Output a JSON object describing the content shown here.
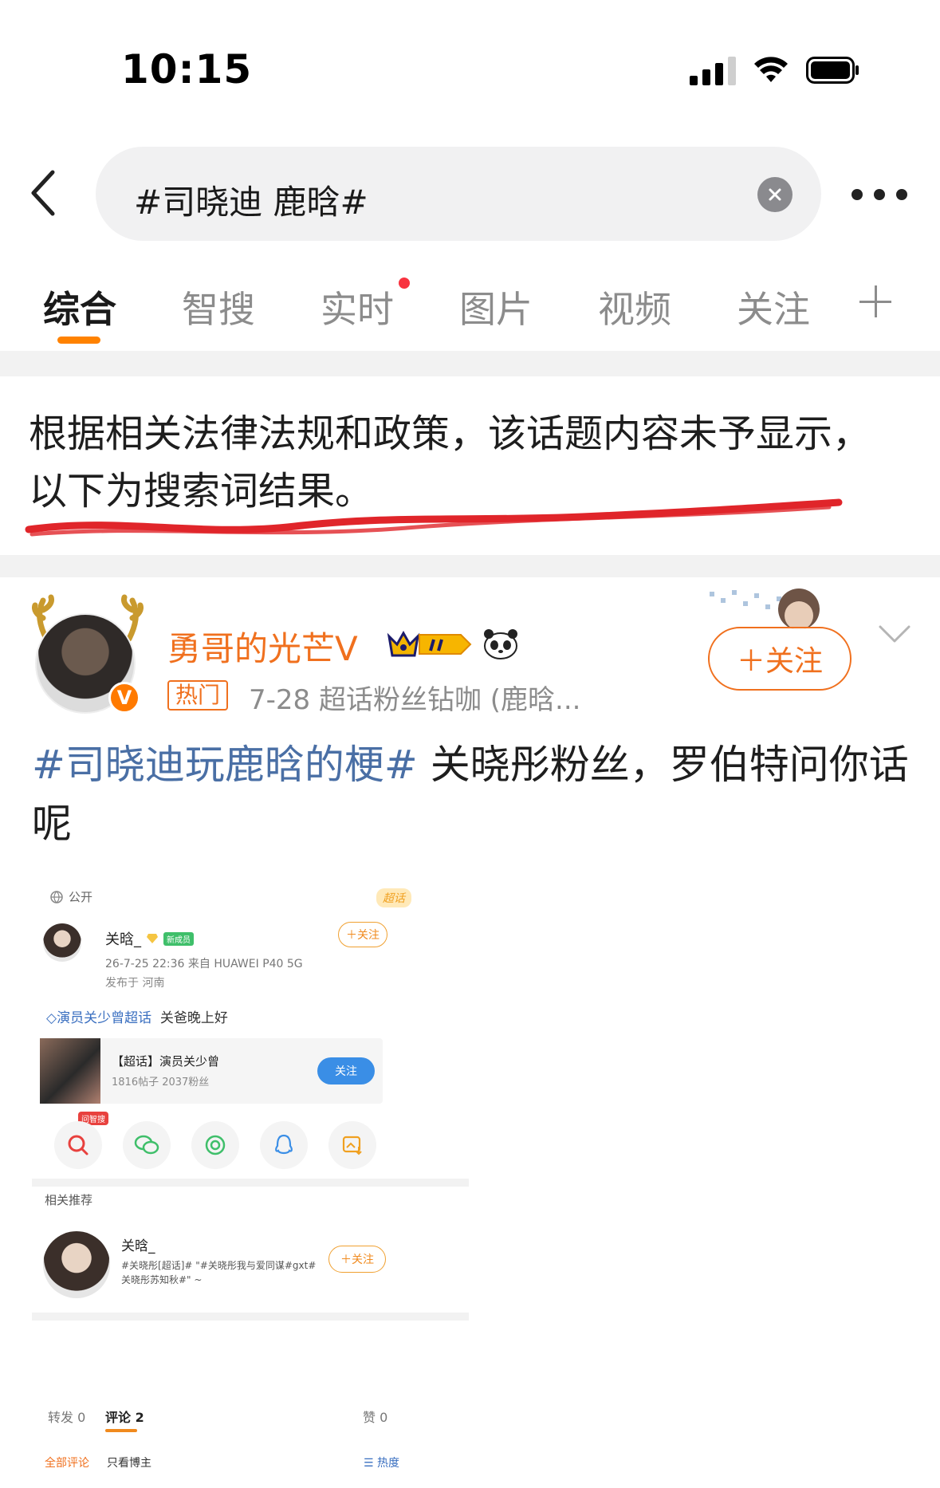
{
  "status_bar": {
    "time": "10:15"
  },
  "search": {
    "query": "#司晓迪 鹿晗#"
  },
  "tabs": [
    {
      "label": "综合"
    },
    {
      "label": "智搜"
    },
    {
      "label": "实时"
    },
    {
      "label": "图片"
    },
    {
      "label": "视频"
    },
    {
      "label": "关注"
    }
  ],
  "notice": {
    "text": "根据相关法律法规和政策，该话题内容未予显示，以下为搜索词结果。"
  },
  "post": {
    "username": "勇哥的光芒V",
    "hot_tag": "热门",
    "meta": "7-28  超话粉丝钻咖 (鹿晗...",
    "follow_label": "＋关注",
    "hashtag": "#司晓迪玩鹿晗的梗#",
    "body": " 关晓彤粉丝，罗伯特问你话呢"
  },
  "screenshot": {
    "visibility": "公开",
    "chaohua_badge": "超话",
    "author": "关晗_",
    "new_member_tag": "新成员",
    "follow_label": "＋关注",
    "meta_line": "26-7-25 22:36  来自 HUAWEI P40 5G",
    "location": "发布于 河南",
    "topic_link": "演员关少曾超话",
    "topic_text": "关爸晚上好",
    "card_title": "【超话】演员关少曾",
    "card_sub": "1816帖子 2037粉丝",
    "card_button": "关注",
    "ai_tag": "问智搜",
    "recommend_title": "相关推荐",
    "rec_name": "关晗_",
    "rec_desc": "#关晓彤[超话]# \"#关晓彤我与爱同谋#gxt# 关晓彤苏知秋#\" ~",
    "rec_follow": "＋关注",
    "tab_repost": "转发 0",
    "tab_comment": "评论 2",
    "tab_like": "赞 0",
    "filter_all": "全部评论",
    "filter_author": "只看博主",
    "filter_sort": "热度"
  },
  "colors": {
    "accent": "#ff8200",
    "username": "#f0701e",
    "hashtag": "#4a6fa5",
    "alert_dot": "#f8333f"
  }
}
